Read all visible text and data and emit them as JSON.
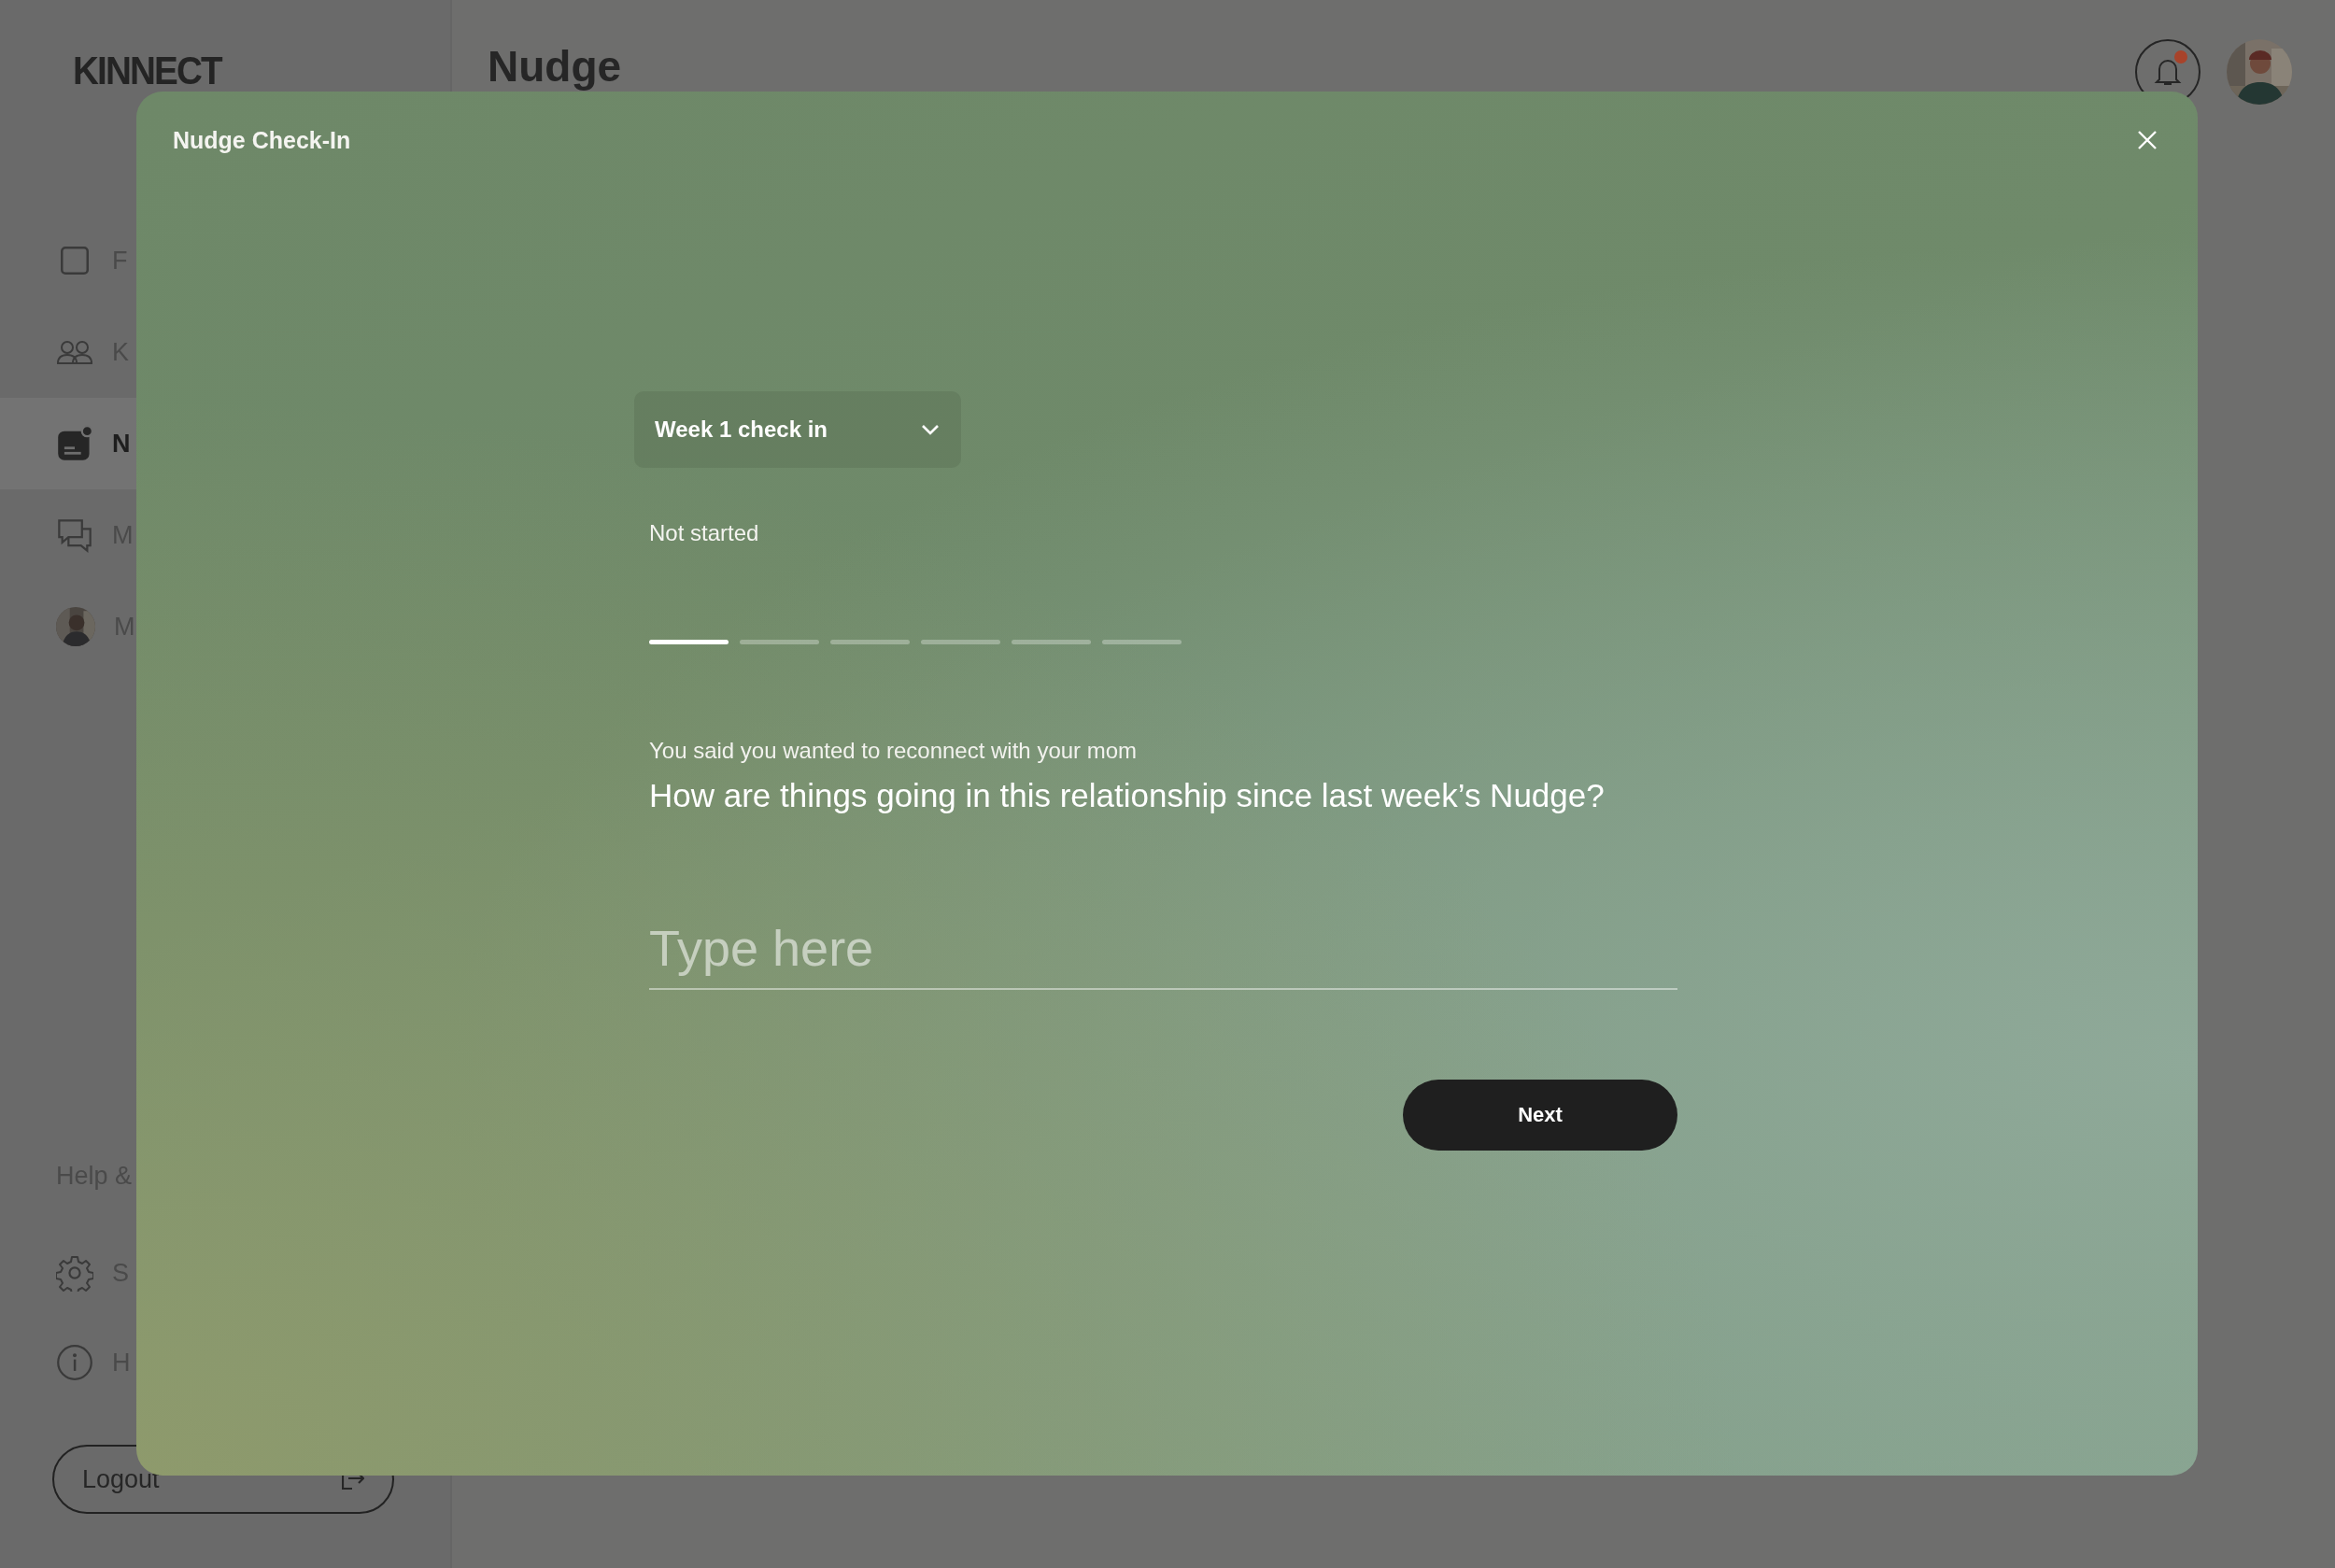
{
  "sidebar": {
    "logo": "KINNECT",
    "nav": [
      {
        "label": "F",
        "selected": false
      },
      {
        "label": "K",
        "selected": false
      },
      {
        "label": "N",
        "selected": true
      },
      {
        "label": "M",
        "selected": false
      },
      {
        "label": "M",
        "selected": false
      }
    ],
    "section_label": "Help &",
    "bottom": [
      {
        "label": "S"
      },
      {
        "label": "H"
      }
    ],
    "logout": "Logout"
  },
  "header": {
    "title": "Nudge",
    "has_notification": true
  },
  "modal": {
    "title": "Nudge Check-In",
    "dropdown": "Week 1 check in",
    "status": "Not started",
    "steps": [
      {
        "selected": true
      },
      {
        "selected": false
      },
      {
        "selected": false
      },
      {
        "selected": false
      },
      {
        "selected": false
      },
      {
        "selected": false
      }
    ],
    "context": "You said you wanted to reconnect with your mom",
    "question": "How are things going in this relationship since last week’s Nudge?",
    "answer": {
      "placeholder": "Type here"
    },
    "next_button": "Next"
  }
}
